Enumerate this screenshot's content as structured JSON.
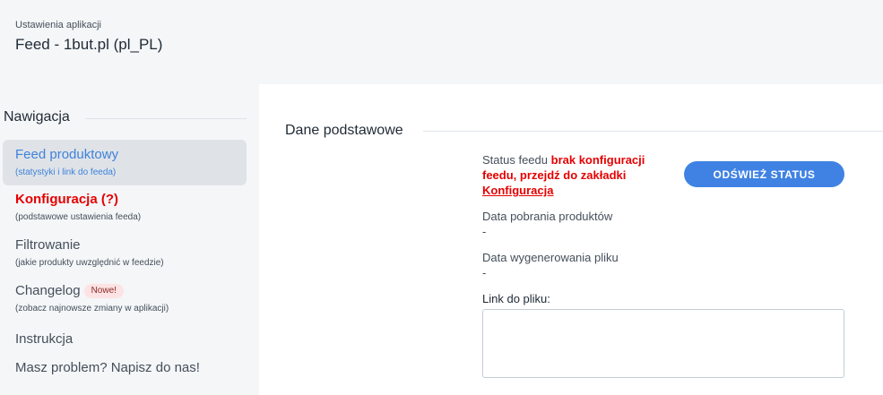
{
  "header": {
    "subtitle": "Ustawienia aplikacji",
    "title": "Feed - 1but.pl (pl_PL)"
  },
  "sidebar": {
    "heading": "Nawigacja",
    "items": [
      {
        "label": "Feed produktowy",
        "sub": "(statystyki i link do feeda)",
        "state": "active"
      },
      {
        "label": "Konfiguracja (?)",
        "sub": "(podstawowe ustawienia feeda)",
        "state": "warning"
      },
      {
        "label": "Filtrowanie",
        "sub": "(jakie produkty uwzględnić w feedzie)",
        "state": "normal"
      },
      {
        "label": "Changelog",
        "badge": "Nowe!",
        "sub": "(zobacz najnowsze zmiany w aplikacji)",
        "state": "normal"
      },
      {
        "label": "Instrukcja",
        "state": "normal"
      },
      {
        "label": "Masz problem? Napisz do nas!",
        "state": "normal"
      }
    ]
  },
  "main": {
    "section_title": "Dane podstawowe",
    "status": {
      "label": "Status feedu",
      "message": "brak konfiguracji feedu, przejdź do zakładki",
      "link_text": "Konfiguracja"
    },
    "refresh_button": "ODŚWIEŻ STATUS",
    "fields": [
      {
        "label": "Data pobrania produktów",
        "value": "-"
      },
      {
        "label": "Data wygenerowania pliku",
        "value": "-"
      }
    ],
    "link": {
      "label": "Link do pliku:",
      "value": ""
    }
  },
  "colors": {
    "accent": "#3f82e3",
    "warning": "#e60000",
    "active_nav_bg": "#dfe3e8",
    "badge_bg": "#fde3e3"
  }
}
